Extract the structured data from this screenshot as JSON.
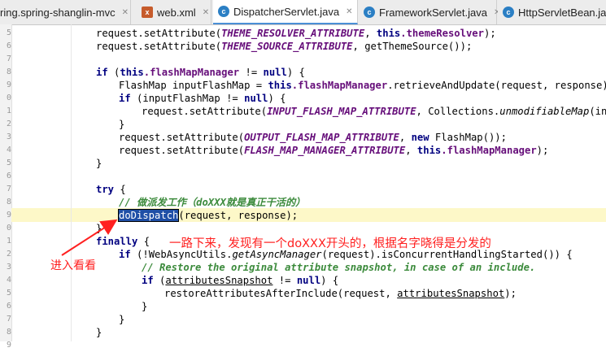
{
  "tabs": [
    {
      "label": "ring.spring-shanglin-mvc",
      "icon": "module-icon",
      "active": false
    },
    {
      "label": "web.xml",
      "icon": "xml-file-icon",
      "active": false
    },
    {
      "label": "DispatcherServlet.java",
      "icon": "class-icon",
      "active": true
    },
    {
      "label": "FrameworkServlet.java",
      "icon": "class-icon",
      "active": false
    },
    {
      "label": "HttpServletBean.ja",
      "icon": "class-icon",
      "active": false
    }
  ],
  "gutter_numbers": [
    "5",
    "6",
    "7",
    "8",
    "9",
    "0",
    "1",
    "2",
    "3",
    "4",
    "5",
    "6",
    "7",
    "8",
    "9",
    "0",
    "1",
    "2",
    "3",
    "4",
    "5",
    "6",
    "7",
    "8",
    "9"
  ],
  "code": {
    "l1": {
      "a": "request.setAttribute(",
      "c": "THEME_RESOLVER_ATTRIBUTE",
      ", this.": "",
      "t": ", ",
      "kw": "this",
      "f": ".themeResolver",
      "e": ");"
    },
    "l2": {
      "a": "request.setAttribute(",
      "c": "THEME_SOURCE_ATTRIBUTE",
      "e": ", getThemeSource());"
    },
    "l4": {
      "kw1": "if",
      "a": " (",
      "kw2": "this",
      "f": ".flashMapManager",
      "b": " != ",
      "kw3": "null",
      "e": ") {"
    },
    "l5": {
      "a": "FlashMap inputFlashMap = ",
      "kw": "this",
      "f": ".flashMapManager",
      "e": ".retrieveAndUpdate(request, response);"
    },
    "l6": {
      "kw1": "if",
      "a": " (inputFlashMap != ",
      "kw2": "null",
      "e": ") {"
    },
    "l7": {
      "a": "request.setAttribute(",
      "c": "INPUT_FLASH_MAP_ATTRIBUTE",
      "b": ", Collections.",
      "m": "unmodifiableMap",
      "e": "(inputF"
    },
    "l8": {
      "e": "}"
    },
    "l9": {
      "a": "request.setAttribute(",
      "c": "OUTPUT_FLASH_MAP_ATTRIBUTE",
      "b": ", ",
      "kw": "new",
      "e": " FlashMap());"
    },
    "l10": {
      "a": "request.setAttribute(",
      "c": "FLASH_MAP_MANAGER_ATTRIBUTE",
      "b": ", ",
      "kw": "this",
      "f": ".flashMapManager",
      "e": ");"
    },
    "l11": {
      "e": "}"
    },
    "l13": {
      "kw": "try",
      "e": " {"
    },
    "l14": {
      "cm": "// 做派发工作（doXXX就是真正干活的）"
    },
    "l15": {
      "sel": "doDispatch",
      "e": "(request, response);"
    },
    "l16": {
      "e": "}"
    },
    "l17": {
      "kw": "finally",
      "e": " {"
    },
    "l18": {
      "kw": "if",
      "a": " (!WebAsyncUtils.",
      "m": "getAsyncManager",
      "e": "(request).isConcurrentHandlingStarted()) {"
    },
    "l19": {
      "cm": "// Restore the original attribute snapshot, in case of an include."
    },
    "l20": {
      "kw": "if",
      "a": " (",
      "u": "attributesSnapshot",
      "b": " != ",
      "kw2": "null",
      "e": ") {"
    },
    "l21": {
      "a": "restoreAttributesAfterInclude(request, ",
      "u": "attributesSnapshot",
      "e": ");"
    },
    "l22": {
      "e": "}"
    },
    "l23": {
      "e": "}"
    }
  },
  "annotations": {
    "main": "一路下来，发现有一个doXXX开头的，根据名字晓得是分发的",
    "enter": "进入看看"
  },
  "colors": {
    "annotation": "#ff2020",
    "selection": "#1f4fa6",
    "comment": "#3b8a3b",
    "keyword": "#000080",
    "constant": "#660e7a"
  }
}
